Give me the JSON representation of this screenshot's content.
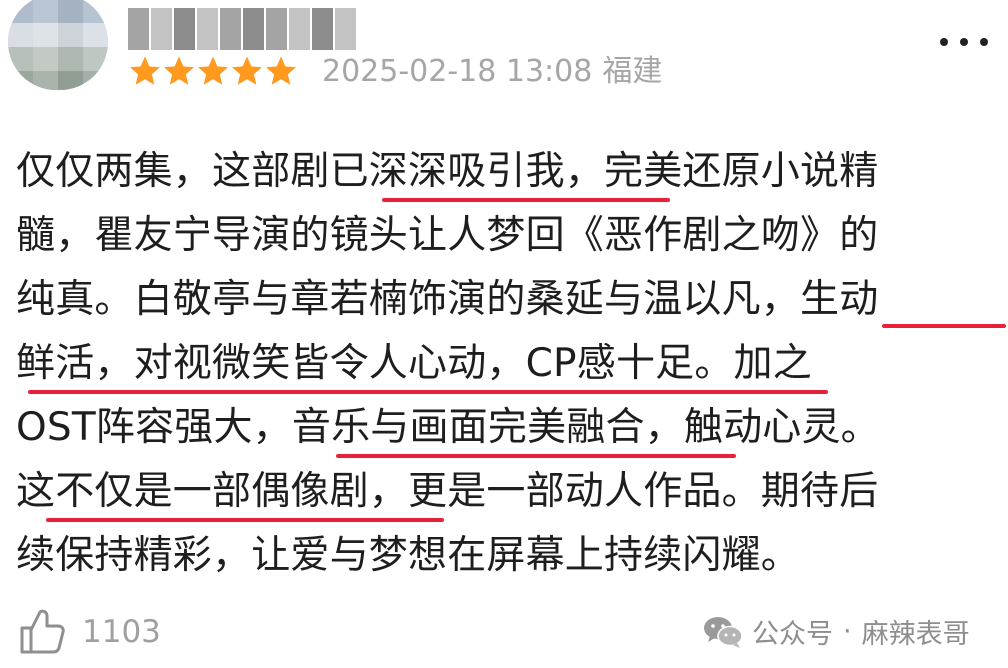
{
  "review": {
    "username": "█████",
    "rating": 5,
    "rating_max": 5,
    "date": "2025-02-18 13:08",
    "location": "福建",
    "body_lines": [
      "仅仅两集，这部剧已深深吸引我，完美还原小说精",
      "髓，瞿友宁导演的镜头让人梦回《恶作剧之吻》的",
      "纯真。白敬亭与章若楠饰演的桑延与温以凡，生动",
      "鲜活，对视微笑皆令人心动，CP感十足。加之",
      "OST阵容强大，音乐与画面完美融合，触动心灵。",
      "这不仅是一部偶像剧，更是一部动人作品。期待后",
      "续保持精彩，让爱与梦想在屏幕上持续闪耀。"
    ],
    "highlight_color": "#e8213a"
  },
  "footer": {
    "like_count": "1103",
    "watermark_source": "公众号",
    "watermark_separator": "·",
    "watermark_account": "麻辣表哥"
  },
  "icons": {
    "star": "star-icon",
    "more": "more-dots-icon",
    "like": "thumb-up-icon",
    "watermark": "wechat-icon"
  },
  "colors": {
    "star": "#ff9a1f",
    "meta_text": "#a6a6a6",
    "underline": "#e8213a"
  }
}
